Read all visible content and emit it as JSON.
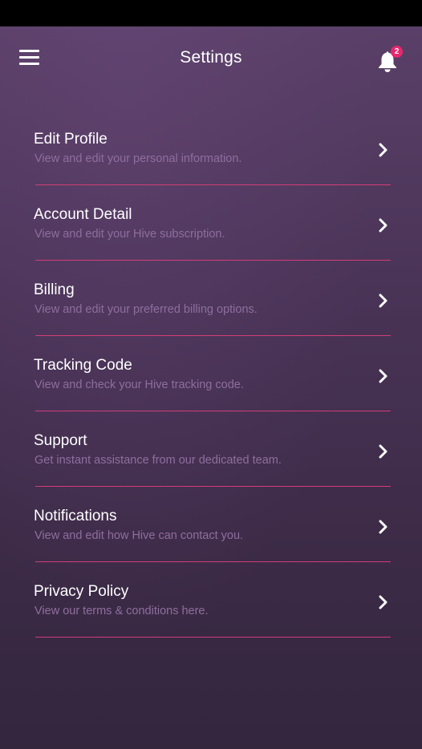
{
  "header": {
    "title": "Settings",
    "menu_icon": "hamburger-menu-icon",
    "notification_icon": "bell-icon",
    "notification_count": "2"
  },
  "settings": {
    "items": [
      {
        "title": "Edit Profile",
        "subtitle": "View and edit your personal information."
      },
      {
        "title": "Account Detail",
        "subtitle": "View and edit your Hive subscription."
      },
      {
        "title": "Billing",
        "subtitle": "View and edit your preferred billing options."
      },
      {
        "title": "Tracking Code",
        "subtitle": "View and check your Hive tracking code."
      },
      {
        "title": "Support",
        "subtitle": "Get instant assistance from our dedicated team."
      },
      {
        "title": "Notifications",
        "subtitle": "View and edit how Hive can contact you."
      },
      {
        "title": "Privacy Policy",
        "subtitle": "View our terms & conditions here."
      }
    ],
    "chevron_icon": "chevron-right-icon"
  },
  "colors": {
    "accent": "#d23d78",
    "badge": "#e8286e",
    "subtitle": "#8e6e9e",
    "background_top": "#5a4068",
    "background_bottom": "#33263d"
  }
}
